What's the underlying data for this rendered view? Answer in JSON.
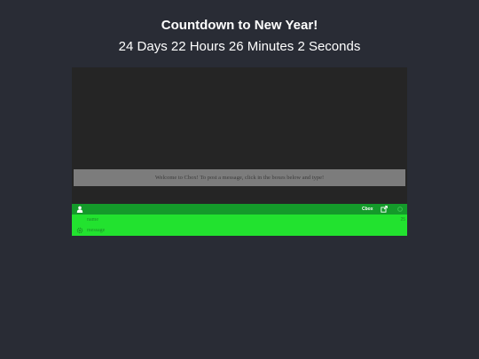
{
  "header": {
    "title": "Countdown to New Year!",
    "countdown": "24 Days 22 Hours 26 Minutes 2 Seconds"
  },
  "chat": {
    "welcome_text": "Welcome to Cbox! To post a message, click in the boxes below and type!",
    "toolbar": {
      "brand_label": "Cbox",
      "user_icon": "user-icon",
      "popout_icon": "external-link-icon",
      "settings_icon": "settings-icon"
    },
    "name_field": {
      "placeholder": "name",
      "value": "",
      "counter": "25"
    },
    "message_field": {
      "placeholder": "message",
      "value": "",
      "counter": ""
    },
    "colors": {
      "page_bg": "#292c35",
      "chat_bg": "#252525",
      "welcome_bg": "#7c7c7c",
      "toolbar_bg": "#149a2a",
      "input_bg": "#22e22f"
    }
  }
}
